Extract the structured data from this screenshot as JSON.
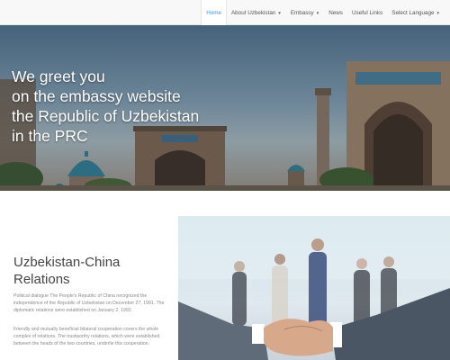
{
  "nav": {
    "items": [
      {
        "label": "Home",
        "active": true
      },
      {
        "label": "About Uzbekistan",
        "dropdown": true
      },
      {
        "label": "Embassy",
        "dropdown": true
      },
      {
        "label": "News"
      },
      {
        "label": "Useful Links"
      },
      {
        "label": "Select Language",
        "dropdown": true
      }
    ]
  },
  "hero": {
    "lines": [
      "We greet you",
      "on the embassy website",
      "the Republic of Uzbekistan",
      "in the PRC"
    ]
  },
  "section": {
    "title": "Uzbekistan-China Relations",
    "paragraphs": [
      "Political dialogue The People's Republic of China recognized the independence of the Republic of Uzbekistan on December 27, 1991. The diplomatic relations were established on January 2, 1992.",
      "Friendly and mutually beneficial bilateral cooperation covers the whole complex of relations. The trustworthy relations, which were established between the heads of the two countries, underlie this cooperation."
    ]
  },
  "colors": {
    "accent": "#3a9bd8",
    "navbar_bg": "#f8f8f8",
    "title_text": "#444444",
    "body_text": "#8a8a8a"
  },
  "icons": {
    "caret": "caret-down-icon"
  }
}
